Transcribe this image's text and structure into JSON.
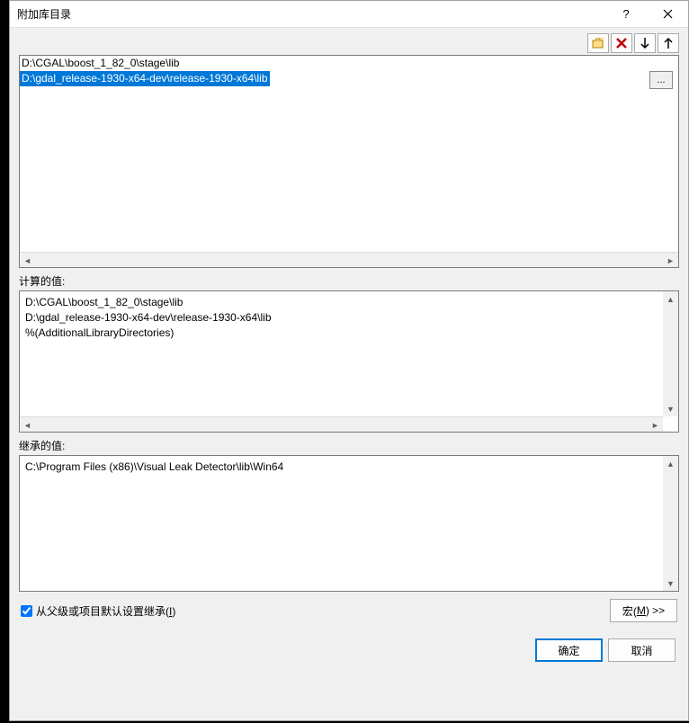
{
  "window": {
    "title": "附加库目录"
  },
  "toolbar": {
    "new_line": "new-line",
    "delete": "delete",
    "move_down": "move-down",
    "move_up": "move-up"
  },
  "editable_list": {
    "items": [
      "D:\\CGAL\\boost_1_82_0\\stage\\lib",
      "D:\\gdal_release-1930-x64-dev\\release-1930-x64\\lib"
    ],
    "selected_index": 1,
    "browse_label": "..."
  },
  "evaluated": {
    "label": "计算的值:",
    "lines": [
      "D:\\CGAL\\boost_1_82_0\\stage\\lib",
      "D:\\gdal_release-1930-x64-dev\\release-1930-x64\\lib",
      "%(AdditionalLibraryDirectories)"
    ]
  },
  "inherited": {
    "label": "继承的值:",
    "lines": [
      "C:\\Program Files (x86)\\Visual Leak Detector\\lib\\Win64"
    ]
  },
  "footer": {
    "inherit_checkbox_label_pre": "从父级或项目默认设置继承(",
    "inherit_checkbox_hotkey": "I",
    "inherit_checkbox_label_post": ")",
    "inherit_checked": true,
    "macros_label_pre": "宏(",
    "macros_hotkey": "M",
    "macros_label_post": ") >>"
  },
  "buttons": {
    "ok": "确定",
    "cancel": "取消"
  }
}
